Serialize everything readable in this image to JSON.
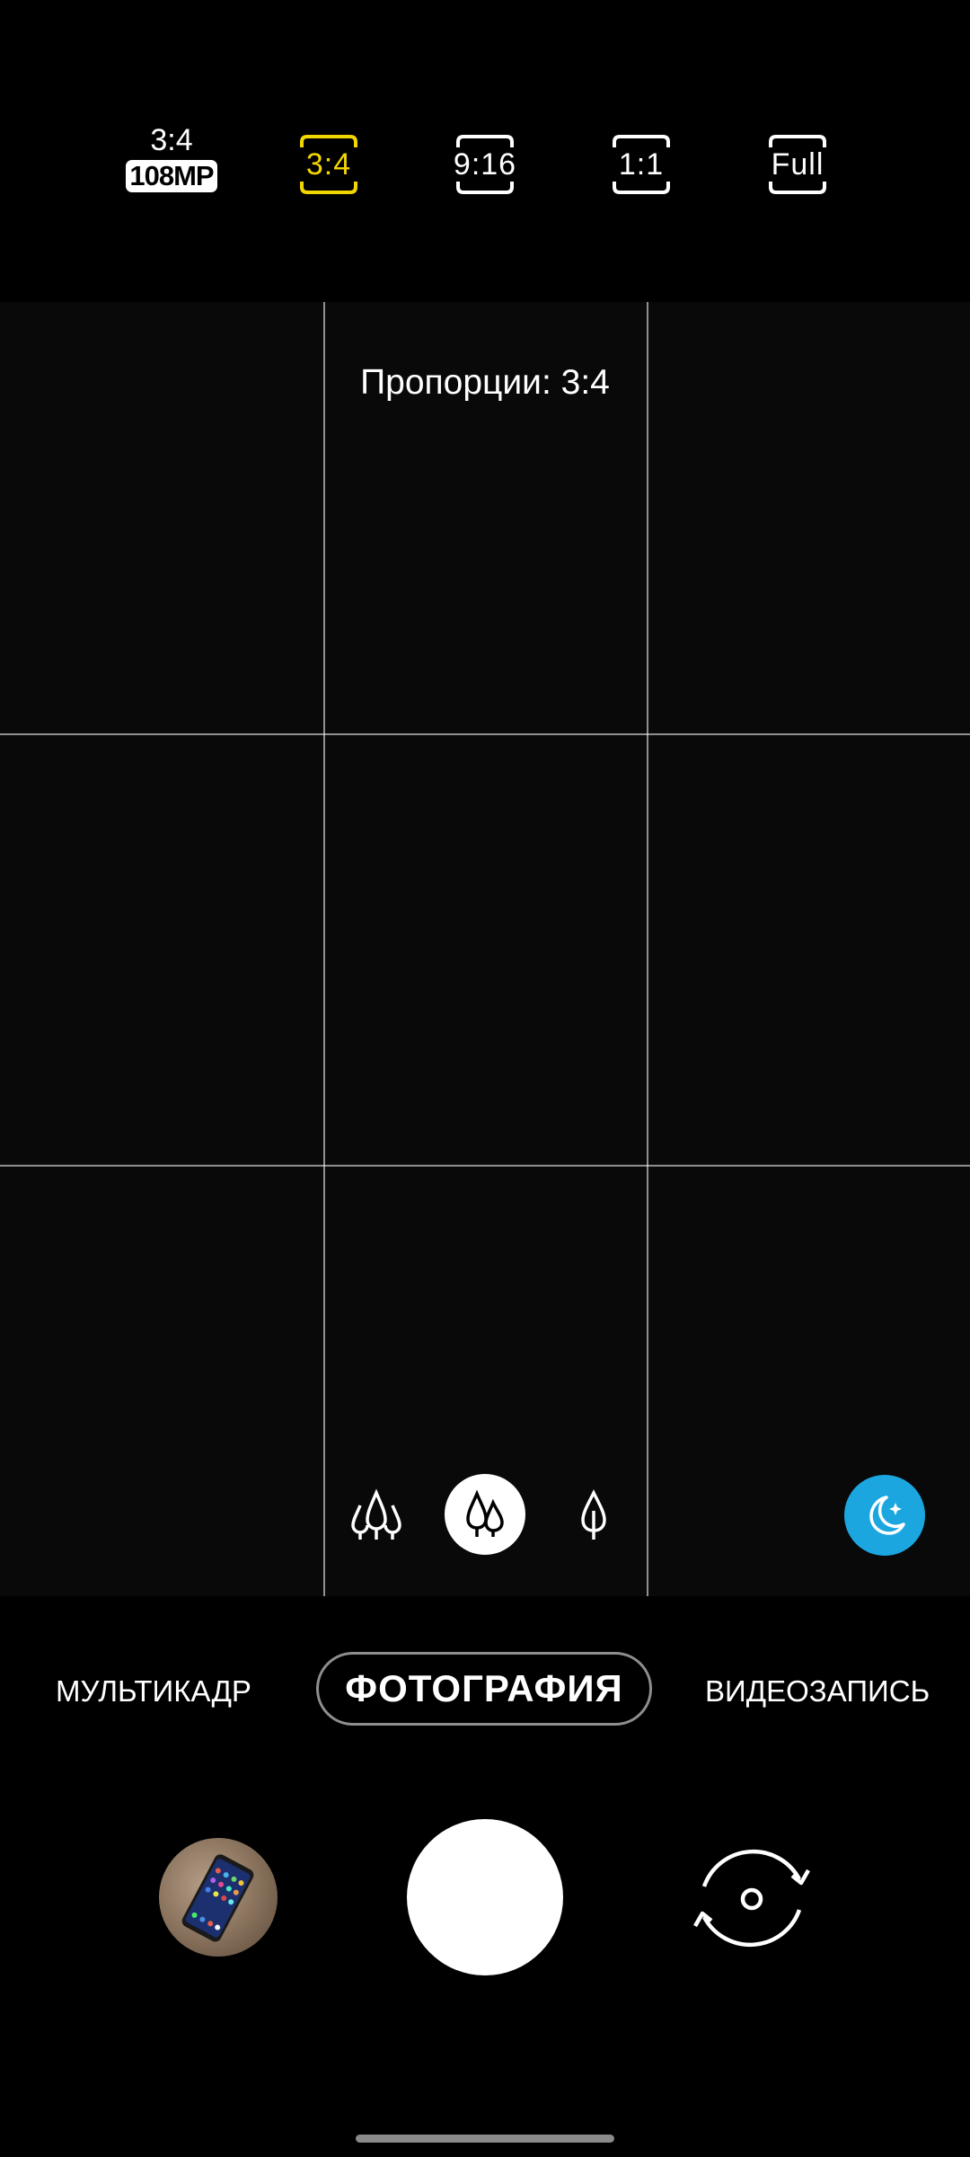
{
  "ratio_bar": {
    "options": [
      {
        "label": "3:4",
        "badge": "108MP",
        "selected": false
      },
      {
        "label": "3:4",
        "selected": true
      },
      {
        "label": "9:16",
        "selected": false
      },
      {
        "label": "1:1",
        "selected": false
      },
      {
        "label": "Full",
        "selected": false
      }
    ],
    "selected_color": "#f2d600"
  },
  "viewfinder": {
    "hint": "Пропорции: 3:4",
    "grid": "3x3",
    "scene_optimizer_icons": [
      "wide-trees-icon",
      "trees-icon",
      "single-tree-icon"
    ],
    "active_zoom_icon": "trees-icon",
    "night_button": {
      "icon": "moon-stars-icon",
      "color": "#1ba6e0"
    }
  },
  "modes": {
    "left": "МУЛЬТИКАДР",
    "active": "ФОТОГРАФИЯ",
    "right": "ВИДЕОЗАПИСЬ"
  },
  "controls": {
    "gallery_icon": "gallery-thumbnail",
    "shutter_icon": "shutter-button",
    "switch_icon": "switch-camera-icon"
  }
}
